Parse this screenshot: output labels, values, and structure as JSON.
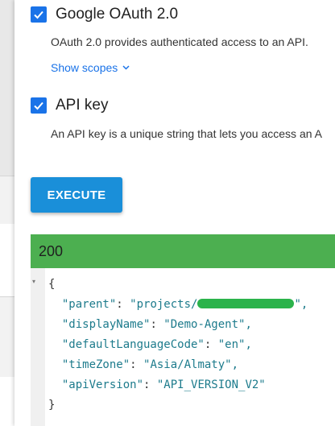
{
  "auth": {
    "oauth_title": "Google OAuth 2.0",
    "oauth_desc": "OAuth 2.0 provides authenticated access to an API.",
    "show_scopes": "Show scopes",
    "apikey_title": "API key",
    "apikey_desc": "An API key is a unique string that lets you access an A"
  },
  "execute_label": "EXECUTE",
  "response": {
    "status_code": "200",
    "body": {
      "open": "{",
      "close": "}",
      "lines": [
        {
          "key": "\"parent\"",
          "value_prefix": "\"projects/",
          "value_suffix": "\","
        },
        {
          "key": "\"displayName\"",
          "value": "\"Demo-Agent\","
        },
        {
          "key": "\"defaultLanguageCode\"",
          "value": "\"en\","
        },
        {
          "key": "\"timeZone\"",
          "value": "\"Asia/Almaty\","
        },
        {
          "key": "\"apiVersion\"",
          "value": "\"API_VERSION_V2\""
        }
      ]
    }
  },
  "colors": {
    "accent": "#1a73e8",
    "execute": "#1a8fd9",
    "success": "#4caf50",
    "redaction": "#2bb34b"
  }
}
